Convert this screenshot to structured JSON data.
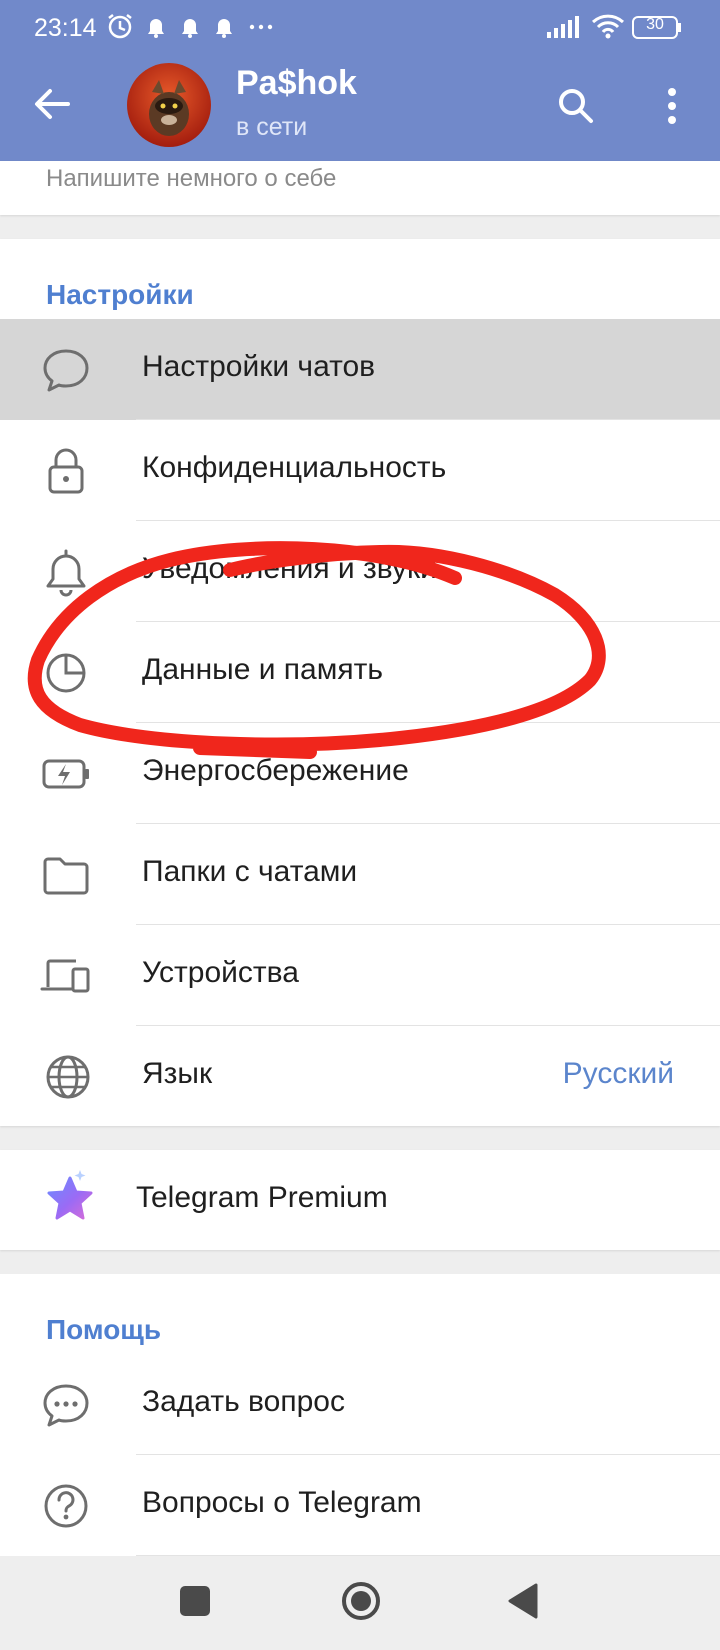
{
  "status_bar": {
    "time": "23:14",
    "battery": "30"
  },
  "header": {
    "name": "Pa$hok",
    "status": "в сети"
  },
  "bio_hint": "Напишите немного о себе",
  "settings_section": {
    "title": "Настройки",
    "items": [
      {
        "label": "Настройки чатов",
        "icon": "chat-bubble-icon"
      },
      {
        "label": "Конфиденциальность",
        "icon": "lock-icon"
      },
      {
        "label": "Уведомления и звуки",
        "icon": "bell-icon"
      },
      {
        "label": "Данные и память",
        "icon": "pie-chart-icon"
      },
      {
        "label": "Энергосбережение",
        "icon": "battery-bolt-icon"
      },
      {
        "label": "Папки с чатами",
        "icon": "folder-icon"
      },
      {
        "label": "Устройства",
        "icon": "devices-icon"
      },
      {
        "label": "Язык",
        "icon": "globe-icon",
        "value": "Русский"
      }
    ]
  },
  "premium": {
    "label": "Telegram Premium",
    "icon": "premium-star-icon"
  },
  "help_section": {
    "title": "Помощь",
    "items": [
      {
        "label": "Задать вопрос",
        "icon": "ask-question-icon"
      },
      {
        "label": "Вопросы о Telegram",
        "icon": "faq-icon"
      }
    ]
  },
  "colors": {
    "header": "#7189ca",
    "accent": "#4f7fd0",
    "annotation": "#f0261c"
  }
}
